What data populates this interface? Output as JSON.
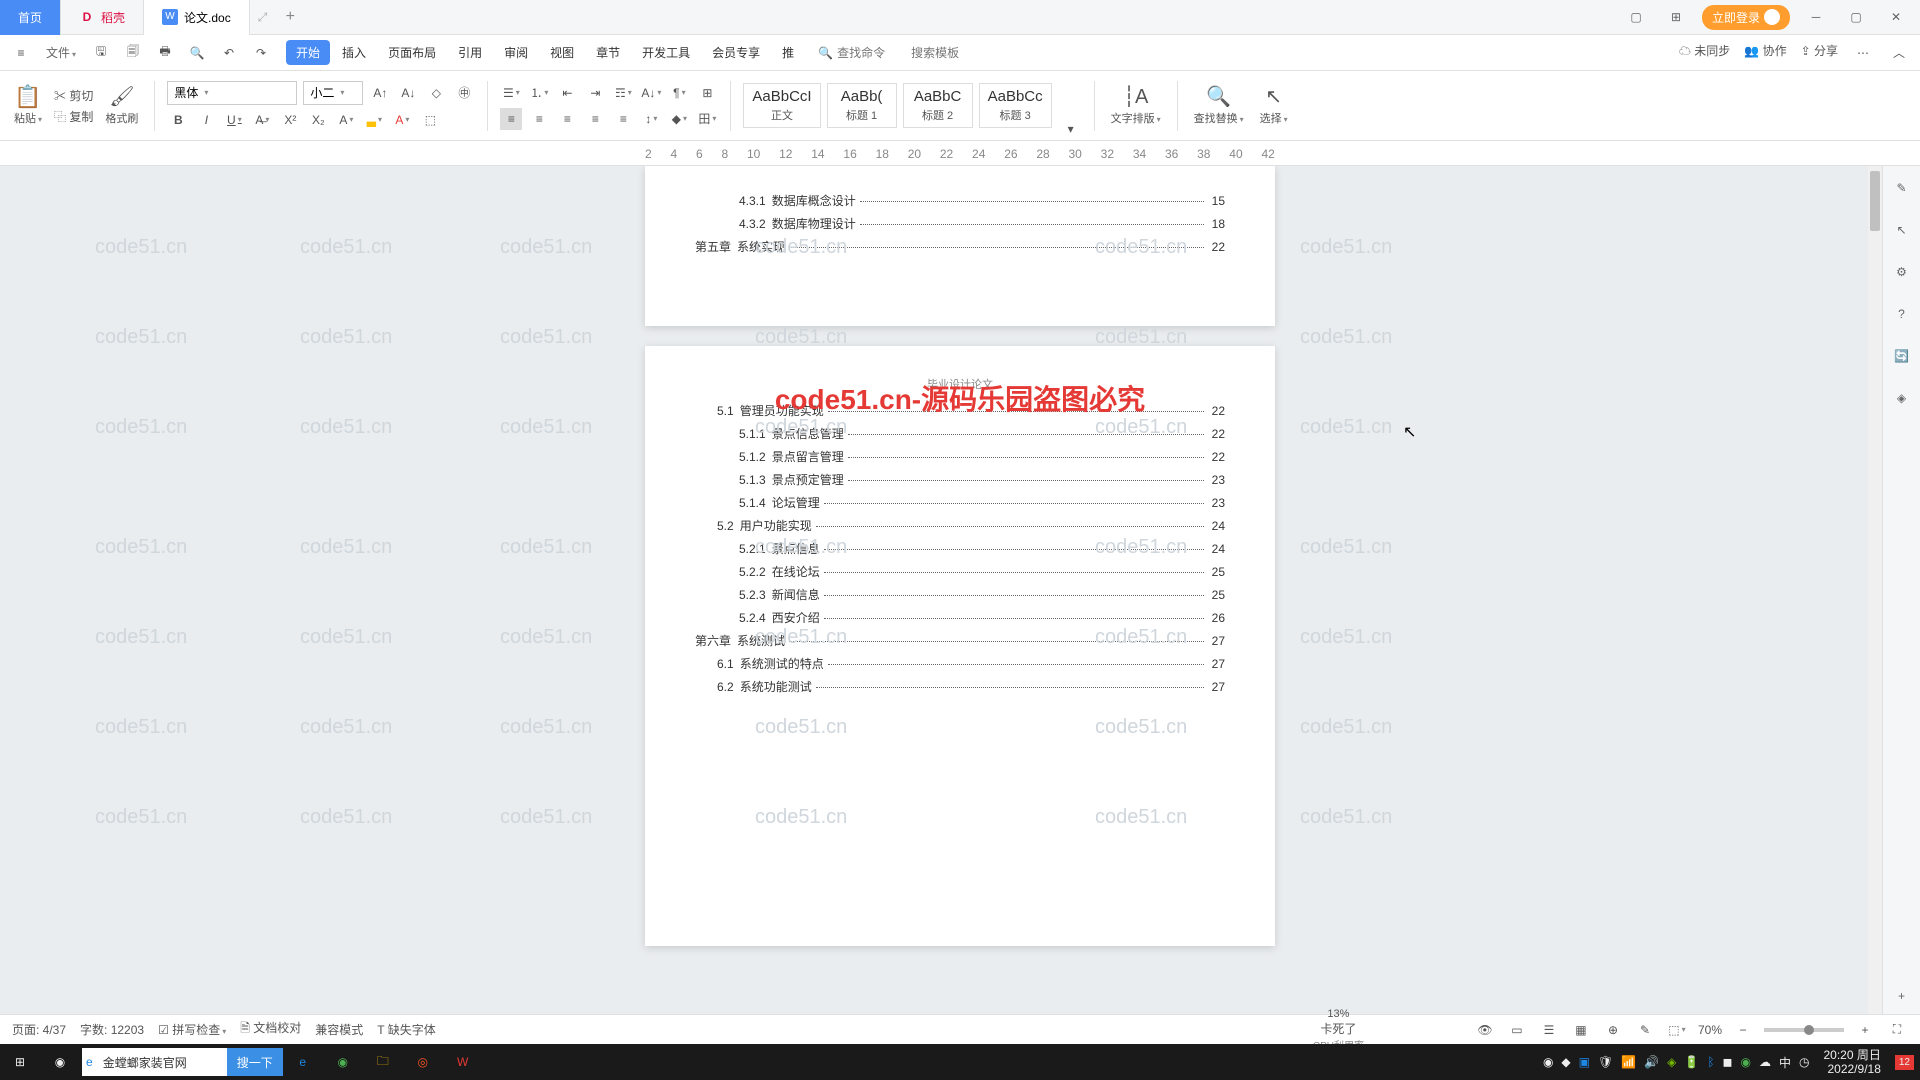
{
  "tabs": {
    "home": "首页",
    "dago": "稻壳",
    "doc": "论文.doc"
  },
  "titlebuttons": {
    "login": "立即登录"
  },
  "menubar": {
    "file": "文件",
    "items": [
      "开始",
      "插入",
      "页面布局",
      "引用",
      "审阅",
      "视图",
      "章节",
      "开发工具",
      "会员专享",
      "推"
    ],
    "active": 0,
    "search_icon_placeholder": "查找命令",
    "search_tpl": "搜索模板",
    "unsynced": "未同步",
    "collab": "协作",
    "share": "分享"
  },
  "ribbon": {
    "paste": "粘贴",
    "cut": "剪切",
    "copy": "复制",
    "brush": "格式刷",
    "font": "黑体",
    "size": "小二",
    "styles": [
      {
        "prev": "AaBbCcI",
        "name": "正文"
      },
      {
        "prev": "AaBb(",
        "name": "标题 1"
      },
      {
        "prev": "AaBbC",
        "name": "标题 2"
      },
      {
        "prev": "AaBbCc",
        "name": "标题 3"
      }
    ],
    "textlayout": "文字排版",
    "findreplace": "查找替换",
    "select": "选择"
  },
  "doc": {
    "page2_header": "毕业设计论文",
    "watermark_text": "code51.cn",
    "red_overlay": "code51.cn-源码乐园盗图必究",
    "toc_p1": [
      {
        "ind": 3,
        "num": "4.3.1",
        "t": "数据库概念设计",
        "pg": "15"
      },
      {
        "ind": 3,
        "num": "4.3.2",
        "t": "数据库物理设计",
        "pg": "18"
      },
      {
        "ind": 1,
        "num": "第五章",
        "t": "系统实现",
        "pg": "22"
      }
    ],
    "toc_p2": [
      {
        "ind": 2,
        "num": "5.1",
        "t": "管理员功能实现",
        "pg": "22"
      },
      {
        "ind": 3,
        "num": "5.1.1",
        "t": "景点信息管理",
        "pg": "22"
      },
      {
        "ind": 3,
        "num": "5.1.2",
        "t": "景点留言管理",
        "pg": "22"
      },
      {
        "ind": 3,
        "num": "5.1.3",
        "t": "景点预定管理",
        "pg": "23"
      },
      {
        "ind": 3,
        "num": "5.1.4",
        "t": "论坛管理",
        "pg": "23"
      },
      {
        "ind": 2,
        "num": "5.2",
        "t": "用户功能实现",
        "pg": "24"
      },
      {
        "ind": 3,
        "num": "5.2.1",
        "t": "景点信息",
        "pg": "24"
      },
      {
        "ind": 3,
        "num": "5.2.2",
        "t": "在线论坛",
        "pg": "25"
      },
      {
        "ind": 3,
        "num": "5.2.3",
        "t": "新闻信息",
        "pg": "25"
      },
      {
        "ind": 3,
        "num": "5.2.4",
        "t": "西安介绍",
        "pg": "26"
      },
      {
        "ind": 1,
        "num": "第六章",
        "t": "系统测试",
        "pg": "27"
      },
      {
        "ind": 2,
        "num": "6.1",
        "t": "系统测试的特点",
        "pg": "27"
      },
      {
        "ind": 2,
        "num": "6.2",
        "t": "系统功能测试",
        "pg": "27"
      }
    ]
  },
  "status": {
    "page": "页面: 4/37",
    "words": "字数: 12203",
    "spell": "拼写检查",
    "review": "文档校对",
    "compat": "兼容模式",
    "missing": "缺失字体",
    "zoom": "70%",
    "cpulabel": "CPU利用率",
    "topmsg": "卡死了",
    "pct": "13%"
  },
  "taskbar": {
    "browser_title": "金螳螂家装官网",
    "search_btn": "搜一下",
    "time": "20:20",
    "day": "周日",
    "date": "2022/9/18",
    "ime": "中"
  }
}
